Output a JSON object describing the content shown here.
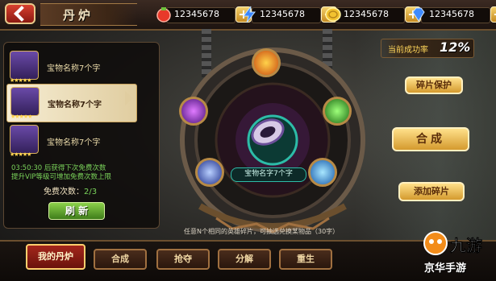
{
  "header": {
    "title": "丹炉"
  },
  "resources": [
    {
      "icon": "red-gem-icon",
      "value": "12345678",
      "color": "#e8392a"
    },
    {
      "icon": "lightning-icon",
      "value": "12345678",
      "color": "#3a86ff"
    },
    {
      "icon": "gold-coin-icon",
      "value": "12345678",
      "color": "#f2c230"
    },
    {
      "icon": "blue-diamond-icon",
      "value": "12345678",
      "color": "#3f8bff"
    }
  ],
  "plus_label": "+",
  "treasure_list": [
    {
      "name": "宝物名称7个字",
      "stars": "★★★★★",
      "selected": false
    },
    {
      "name": "宝物名称7个字",
      "stars": "★★★★★",
      "selected": true
    },
    {
      "name": "宝物名称7个字",
      "stars": "★★★★★",
      "selected": false
    }
  ],
  "free_info": {
    "line1": "03:50:30 后获得下次免费次数",
    "line2": "提升VIP等级可增加免费次数上限",
    "count_label": "免费次数：",
    "count_value": "2/3"
  },
  "refresh_button": "刷 新",
  "success_rate": {
    "label": "当前成功率",
    "value": "12%"
  },
  "furnace": {
    "slot_name": "宝物名字7个字",
    "orbs": [
      {
        "icon": "fire-orb-icon",
        "color": "#f07a1a"
      },
      {
        "icon": "poison-orb-icon",
        "color": "#8a3cf0"
      },
      {
        "icon": "wind-orb-icon",
        "color": "#3fd43a"
      },
      {
        "icon": "lightning-orb-icon",
        "color": "#3b6cff"
      },
      {
        "icon": "water-orb-icon",
        "color": "#2aa9ff"
      }
    ]
  },
  "buttons": {
    "fragment_protect": "碎片保护",
    "synthesize": "合成",
    "add_fragment": "添加碎片"
  },
  "hint": "任意N个相同的英雄碎片，可抽选兑换某物品（30字）",
  "tabs": [
    {
      "label": "我的丹炉",
      "active": true
    },
    {
      "label": "合成",
      "active": false
    },
    {
      "label": "抢夺",
      "active": false
    },
    {
      "label": "分解",
      "active": false
    },
    {
      "label": "重生",
      "active": false
    }
  ],
  "watermark": {
    "logo": "九游",
    "text": "京华手游"
  }
}
